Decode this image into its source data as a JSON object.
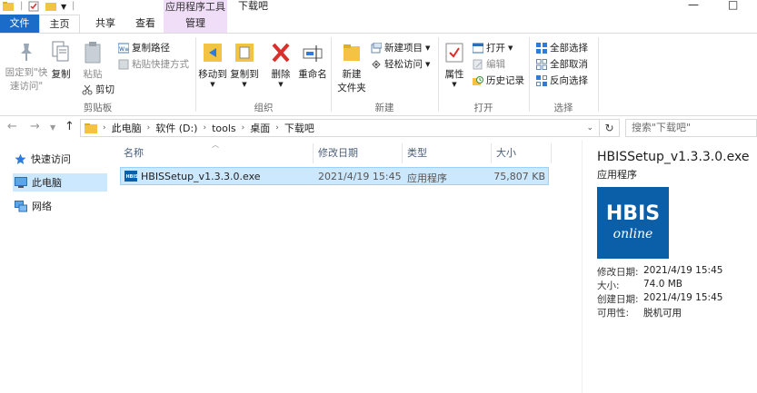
{
  "window": {
    "title": "下载吧",
    "context_tab_label": "应用程序工具",
    "maximize_glyph": "□",
    "minimize_glyph": "—"
  },
  "tabs": {
    "file": "文件",
    "home": "主页",
    "share": "共享",
    "view": "查看",
    "manage": "管理"
  },
  "ribbon": {
    "clipboard": {
      "pin_label_line1": "固定到\"快",
      "pin_label_line2": "速访问\"",
      "copy": "复制",
      "paste": "粘贴",
      "copy_path": "复制路径",
      "paste_shortcut": "粘贴快捷方式",
      "cut": "剪切",
      "group": "剪贴板"
    },
    "organize": {
      "move_to": "移动到",
      "copy_to": "复制到",
      "delete": "删除",
      "rename": "重命名",
      "group": "组织"
    },
    "new": {
      "new_folder_line1": "新建",
      "new_folder_line2": "文件夹",
      "new_item": "新建项目",
      "easy_access": "轻松访问",
      "group": "新建"
    },
    "open": {
      "properties": "属性",
      "open": "打开",
      "edit": "编辑",
      "history": "历史记录",
      "group": "打开"
    },
    "select": {
      "select_all": "全部选择",
      "select_none": "全部取消",
      "invert": "反向选择",
      "group": "选择"
    }
  },
  "address": {
    "crumbs": [
      "此电脑",
      "软件 (D:)",
      "tools",
      "桌面",
      "下载吧"
    ],
    "search_placeholder": "搜索\"下载吧\""
  },
  "nav": {
    "items": [
      "快速访问",
      "此电脑",
      "网络"
    ]
  },
  "list": {
    "columns": [
      "名称",
      "修改日期",
      "类型",
      "大小"
    ],
    "rows": [
      {
        "name": "HBISSetup_v1.3.3.0.exe",
        "modified": "2021/4/19 15:45",
        "type": "应用程序",
        "size": "75,807 KB"
      }
    ]
  },
  "preview": {
    "name": "HBISSetup_v1.3.3.0.exe",
    "type": "应用程序",
    "logo_line1": "HBIS",
    "logo_line2": "online",
    "props": [
      {
        "k": "修改日期:",
        "v": "2021/4/19 15:45"
      },
      {
        "k": "大小:",
        "v": "74.0 MB"
      },
      {
        "k": "创建日期:",
        "v": "2021/4/19 15:45"
      },
      {
        "k": "可用性:",
        "v": "脱机可用"
      }
    ]
  },
  "colors": {
    "file_tab": "#1a6cc8",
    "context_tab": "#f0ddf7",
    "selection": "#cce8ff",
    "logo_bg": "#0b5ea8"
  }
}
